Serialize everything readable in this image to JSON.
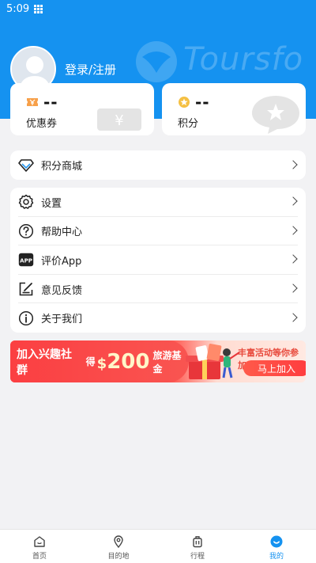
{
  "status": {
    "time": "5:09"
  },
  "header": {
    "brand_watermark": "Toursfo",
    "login_label": "登录/注册"
  },
  "stats": [
    {
      "value": "--",
      "label": "优惠券",
      "icon": "coupon-icon"
    },
    {
      "value": "--",
      "label": "积分",
      "icon": "points-medal-icon"
    }
  ],
  "shop": {
    "label": "积分商城",
    "icon": "diamond-icon"
  },
  "menu": [
    {
      "label": "设置",
      "icon": "gear-icon"
    },
    {
      "label": "帮助中心",
      "icon": "help-icon"
    },
    {
      "label": "评价App",
      "icon": "app-icon"
    },
    {
      "label": "意见反馈",
      "icon": "feedback-icon"
    },
    {
      "label": "关于我们",
      "icon": "info-icon"
    }
  ],
  "banner": {
    "text1": "加入兴趣社群",
    "text2": "得",
    "currency": "$",
    "amount": "200",
    "text3": "旅游基金",
    "promo": "丰富活动等你参加",
    "button": "马上加入"
  },
  "tabs": [
    {
      "label": "首页",
      "icon": "home-icon",
      "active": false
    },
    {
      "label": "目的地",
      "icon": "location-pin-icon",
      "active": false
    },
    {
      "label": "行程",
      "icon": "luggage-icon",
      "active": false
    },
    {
      "label": "我的",
      "icon": "profile-smile-icon",
      "active": true
    }
  ],
  "colors": {
    "primary": "#1592f0",
    "banner_red": "#fb3f42",
    "background": "#f2f2f4"
  }
}
